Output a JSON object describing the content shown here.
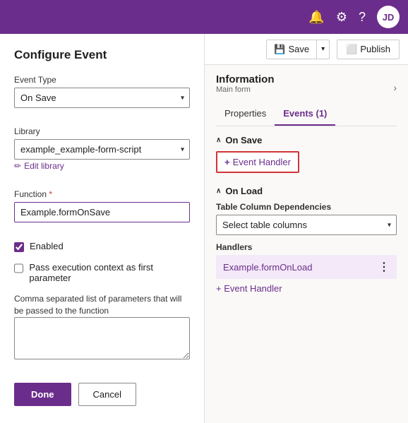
{
  "topbar": {
    "avatar_label": "JD",
    "bell_icon": "🔔",
    "gear_icon": "⚙",
    "help_icon": "?"
  },
  "configure_event": {
    "title": "Configure Event",
    "event_type_label": "Event Type",
    "event_type_value": "On Save",
    "library_label": "Library",
    "library_value": "example_example-form-script",
    "edit_library_label": "Edit library",
    "function_label": "Function",
    "function_required": "*",
    "function_value": "Example.formOnSave",
    "enabled_label": "Enabled",
    "pass_context_label": "Pass execution context as first parameter",
    "params_label": "Comma separated list of parameters that will be passed to the function",
    "done_label": "Done",
    "cancel_label": "Cancel"
  },
  "right_panel": {
    "save_label": "Save",
    "publish_label": "Publish",
    "info_title": "Information",
    "info_subtitle": "Main form",
    "tabs": [
      {
        "label": "Properties",
        "active": false
      },
      {
        "label": "Events (1)",
        "active": true
      }
    ],
    "on_save_section": {
      "title": "On Save",
      "event_handler_label": "+ Event Handler"
    },
    "on_load_section": {
      "title": "On Load",
      "table_column_label": "Table Column Dependencies",
      "table_column_placeholder": "Select table columns",
      "handlers_label": "Handlers",
      "handler_name": "Example.formOnLoad",
      "add_handler_label": "+ Event Handler"
    }
  }
}
